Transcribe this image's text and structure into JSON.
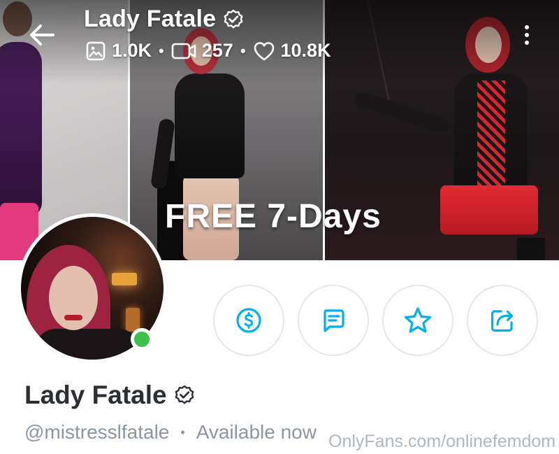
{
  "header": {
    "name": "Lady Fatale",
    "stats": {
      "photos": "1.0K",
      "videos": "257",
      "likes": "10.8K"
    }
  },
  "banner": {
    "promo_text": "FREE 7-Days"
  },
  "profile": {
    "name": "Lady Fatale",
    "handle": "@mistresslfatale",
    "status": "Available now",
    "online": true
  },
  "actions": [
    "send-tip",
    "message",
    "add-to-favorites",
    "share"
  ],
  "watermark": "OnlyFans.com/onlinefemdom",
  "colors": {
    "accent": "#00aff0",
    "online": "#3cc14a",
    "text_primary": "#2b2f33",
    "text_secondary": "#8a96a3",
    "button_border": "#e3e6ea"
  }
}
